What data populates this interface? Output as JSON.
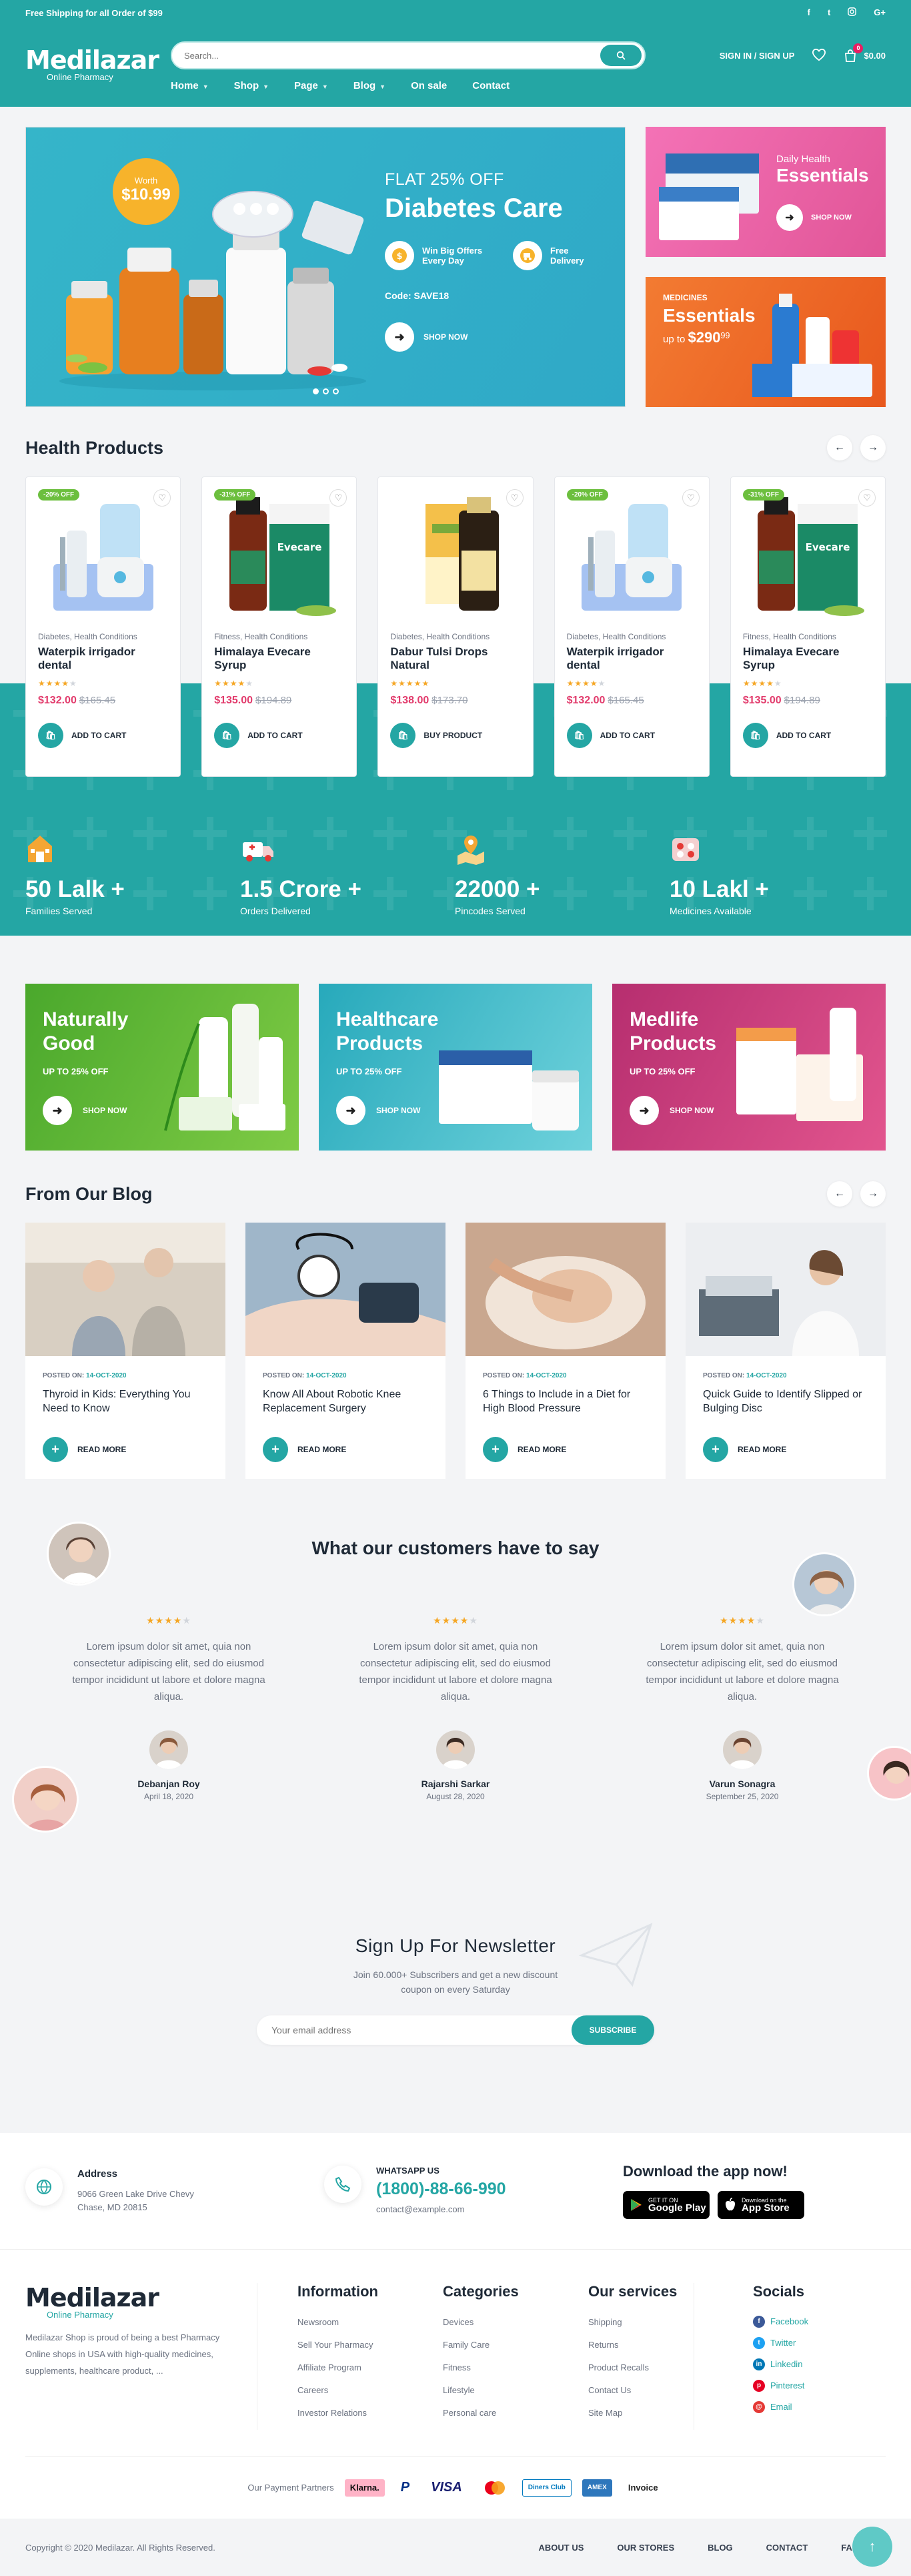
{
  "topbar": {
    "shipping": "Free Shipping for all Order of $99",
    "social": [
      "f",
      "t",
      "ig",
      "G+"
    ]
  },
  "logo": {
    "name": "Medilazar",
    "sub": "Online Pharmacy"
  },
  "search": {
    "placeholder": "Search..."
  },
  "header": {
    "signin": "SIGN IN / SIGN UP",
    "cart_count": "0",
    "cart_total": "$0.00"
  },
  "nav": [
    {
      "label": "Home",
      "dropdown": true
    },
    {
      "label": "Shop",
      "dropdown": true
    },
    {
      "label": "Page",
      "dropdown": true
    },
    {
      "label": "Blog",
      "dropdown": true
    },
    {
      "label": "On sale",
      "dropdown": false
    },
    {
      "label": "Contact",
      "dropdown": false
    }
  ],
  "hero": {
    "worth_label": "Worth",
    "worth_price": "$10.99",
    "kicker": "FLAT 25% OFF",
    "title": "Diabetes Care",
    "feature1": "Win Big Offers Every Day",
    "feature2": "Free Delivery",
    "code": "Code: SAVE18",
    "shop": "SHOP NOW"
  },
  "side1": {
    "line1": "Daily Health",
    "line2": "Essentials",
    "shop": "SHOP NOW"
  },
  "side2": {
    "kicker": "MEDICINES",
    "title": "Essentials",
    "upto": "up to",
    "price": "$290",
    "cents": "99"
  },
  "health": {
    "title": "Health Products",
    "products": [
      {
        "off": "-20% OFF",
        "cat": "Diabetes, Health Conditions",
        "name": "Waterpik irrigador dental",
        "rating": 4,
        "price": "$132.00",
        "old": "$165.45",
        "action": "ADD TO CART",
        "img": "waterpik"
      },
      {
        "off": "-31% OFF",
        "cat": "Fitness, Health Conditions",
        "name": "Himalaya Evecare Syrup",
        "rating": 4,
        "price": "$135.00",
        "old": "$194.89",
        "action": "ADD TO CART",
        "img": "evecare"
      },
      {
        "off": "",
        "cat": "Diabetes, Health Conditions",
        "name": "Dabur Tulsi Drops Natural",
        "rating": 5,
        "price": "$138.00",
        "old": "$173.70",
        "action": "BUY PRODUCT",
        "img": "dabur"
      },
      {
        "off": "-20% OFF",
        "cat": "Diabetes, Health Conditions",
        "name": "Waterpik irrigador dental",
        "rating": 4,
        "price": "$132.00",
        "old": "$165.45",
        "action": "ADD TO CART",
        "img": "waterpik"
      },
      {
        "off": "-31% OFF",
        "cat": "Fitness, Health Conditions",
        "name": "Himalaya Evecare Syrup",
        "rating": 4,
        "price": "$135.00",
        "old": "$194.89",
        "action": "ADD TO CART",
        "img": "evecare"
      }
    ]
  },
  "stats": [
    {
      "num": "50 Lalk +",
      "label": "Families Served",
      "icon": "house-icon"
    },
    {
      "num": "1.5 Crore +",
      "label": "Orders Delivered",
      "icon": "delivery-truck-icon"
    },
    {
      "num": "22000 +",
      "label": "Pincodes Served",
      "icon": "map-pin-icon"
    },
    {
      "num": "10 Lakl +",
      "label": "Medicines Available",
      "icon": "pills-icon"
    }
  ],
  "promos": [
    {
      "t1": "Naturally",
      "t2": "Good",
      "upto": "UP TO 25% OFF",
      "shop": "SHOP NOW",
      "color": "#5cb838"
    },
    {
      "t1": "Healthcare",
      "t2": "Products",
      "upto": "UP TO 25% OFF",
      "shop": "SHOP NOW",
      "color": "#2fb4c4"
    },
    {
      "t1": "Medlife",
      "t2": "Products",
      "upto": "UP TO 25% OFF",
      "shop": "SHOP NOW",
      "color": "#c93a7c"
    }
  ],
  "blog": {
    "title": "From Our Blog",
    "posted": "POSTED ON:",
    "more": "READ MORE",
    "posts": [
      {
        "date": "14-OCT-2020",
        "title": "Thyroid in Kids: Everything You Need to Know"
      },
      {
        "date": "14-OCT-2020",
        "title": "Know All About Robotic Knee Replacement Surgery"
      },
      {
        "date": "14-OCT-2020",
        "title": "6 Things to Include in a Diet for High Blood Pressure"
      },
      {
        "date": "14-OCT-2020",
        "title": "Quick Guide to Identify Slipped or Bulging Disc"
      }
    ]
  },
  "testimonials": {
    "title": "What our customers have to say",
    "items": [
      {
        "text": "Lorem ipsum dolor sit amet, quia non consectetur adipiscing elit, sed do eiusmod tempor incididunt ut labore et dolore magna aliqua.",
        "name": "Debanjan Roy",
        "date": "April 18, 2020",
        "rating": 4
      },
      {
        "text": "Lorem ipsum dolor sit amet, quia non consectetur adipiscing elit, sed do eiusmod tempor incididunt ut labore et dolore magna aliqua.",
        "name": "Rajarshi Sarkar",
        "date": "August 28, 2020",
        "rating": 4
      },
      {
        "text": "Lorem ipsum dolor sit amet, quia non consectetur adipiscing elit, sed do eiusmod tempor incididunt ut labore et dolore magna aliqua.",
        "name": "Varun Sonagra",
        "date": "September 25, 2020",
        "rating": 4
      }
    ]
  },
  "newsletter": {
    "title": "Sign Up For Newsletter",
    "desc1": "Join 60.000+ Subscribers and get a new discount",
    "desc2": "coupon on every Saturday",
    "placeholder": "Your email address",
    "button": "SUBSCRIBE"
  },
  "contact": {
    "addr_title": "Address",
    "addr": "9066 Green Lake Drive Chevy Chase, MD 20815",
    "wa_title": "WHATSAPP US",
    "phone": "(1800)-88-66-990",
    "email": "contact@example.com",
    "app_title": "Download the app now!",
    "gplay_small": "GET IT ON",
    "gplay": "Google Play",
    "apple_small": "Download on the",
    "apple": "App Store"
  },
  "footer": {
    "about": "Medilazar Shop is proud of being a best Pharmacy Online shops in USA with high-quality medicines, supplements, healthcare product, ...",
    "columns": [
      {
        "title": "Information",
        "items": [
          "Newsroom",
          "Sell Your Pharmacy",
          "Affiliate Program",
          "Careers",
          "Investor Relations"
        ]
      },
      {
        "title": "Categories",
        "items": [
          "Devices",
          "Family Care",
          "Fitness",
          "Lifestyle",
          "Personal care"
        ]
      },
      {
        "title": "Our services",
        "items": [
          "Shipping",
          "Returns",
          "Product Recalls",
          "Contact Us",
          "Site Map"
        ]
      }
    ],
    "socials_title": "Socials",
    "socials": [
      {
        "label": "Facebook",
        "color": "#3b5998",
        "g": "f"
      },
      {
        "label": "Twitter",
        "color": "#1da1f2",
        "g": "t"
      },
      {
        "label": "Linkedin",
        "color": "#0077b5",
        "g": "in"
      },
      {
        "label": "Pinterest",
        "color": "#e60023",
        "g": "p"
      },
      {
        "label": "Email",
        "color": "#e53935",
        "g": "@"
      }
    ],
    "partners_label": "Our Payment Partners",
    "partners": [
      "Klarna.",
      "P",
      "VISA",
      "●●",
      "Diners Club",
      "AMEX",
      "Invoice"
    ],
    "copyright": "Copyright © 2020 Medilazar. All Rights Reserved.",
    "links": [
      "ABOUT US",
      "OUR STORES",
      "BLOG",
      "CONTACT",
      "FAQ"
    ]
  },
  "colors": {
    "primary": "#24a6a4",
    "price": "#e23b6c",
    "star": "#f5a623"
  }
}
